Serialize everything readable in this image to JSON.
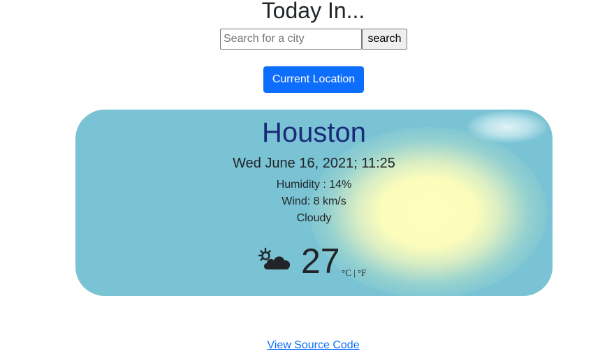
{
  "header": {
    "title": "Today In..."
  },
  "search": {
    "placeholder": "Search for a city",
    "value": "",
    "button_label": "search"
  },
  "location_button_label": "Current Location",
  "weather": {
    "city": "Houston",
    "datetime": "Wed June 16, 2021; 11:25",
    "humidity": "Humidity : 14%",
    "wind": "Wind: 8 km/s",
    "condition": "Cloudy",
    "icon": "partly-cloudy-icon",
    "temperature": "27",
    "unit_celsius": "°C",
    "unit_separator": "|",
    "unit_fahrenheit": "°F"
  },
  "footer": {
    "source_link": "View Source Code"
  },
  "colors": {
    "primary_button": "#0d6efd",
    "card_background": "#79c3d4",
    "city_text": "#1b2b7a",
    "link": "#0d6efd"
  }
}
